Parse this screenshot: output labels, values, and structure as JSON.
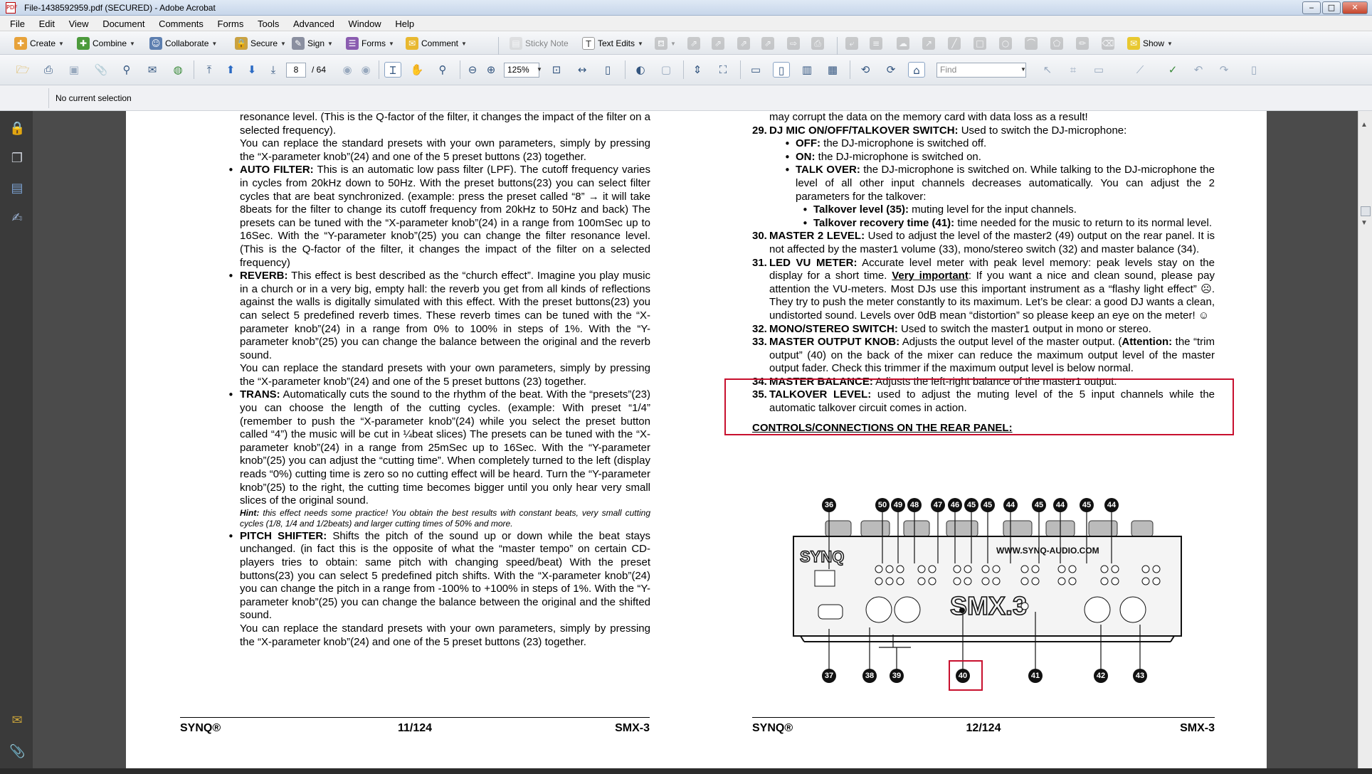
{
  "window": {
    "title": "File-1438592959.pdf (SECURED) - Adobe Acrobat",
    "app_icon": "pdf-icon",
    "controls": {
      "minimize": "‒",
      "maximize": "□",
      "close": "✕"
    }
  },
  "menu": [
    "File",
    "Edit",
    "View",
    "Document",
    "Comments",
    "Forms",
    "Tools",
    "Advanced",
    "Window",
    "Help"
  ],
  "toolbar1": {
    "create": "Create",
    "combine": "Combine",
    "collaborate": "Collaborate",
    "secure": "Secure",
    "sign": "Sign",
    "forms": "Forms",
    "comment": "Comment",
    "sticky_note": "Sticky Note",
    "text_edits": "Text Edits",
    "show": "Show"
  },
  "toolbar2": {
    "page_current": "8",
    "page_total": "/ 64",
    "zoom": "125%",
    "find_placeholder": "Find"
  },
  "status": {
    "selection": "No current selection"
  },
  "left_column": {
    "p1": "resonance level. (This is the Q-factor of the filter, it changes the impact of the filter on a selected frequency).",
    "p2": "You can replace the standard presets with your own parameters, simply by pressing the “X-parameter knob”(24) and one of the 5 preset buttons (23) together.",
    "autofilter_head": "AUTO FILTER:",
    "autofilter_text": " This is an automatic low pass filter (LPF). The cutoff frequency varies in cycles from 20kHz down to 50Hz. With the preset buttons(23) you can select filter cycles that are beat synchronized. (example: press the preset called “8” → it will take 8beats for the filter to change its cutoff frequency from 20kHz to 50Hz and back) The presets can be tuned with the “X-parameter knob”(24) in a range from 100mSec up to 16Sec. With the “Y-parameter knob”(25) you can change the filter resonance level. (This is the Q-factor of the filter, it changes the impact of the filter on a selected frequency)",
    "reverb_head": "REVERB:",
    "reverb_text": " This effect is best described as the “church effect”. Imagine you play music in a church or in a very big, empty hall: the reverb you get from all kinds of reflections against the walls is digitally simulated with this effect. With the preset buttons(23) you can select 5 predefined reverb times. These reverb times can be tuned with the “X-parameter knob”(24) in a range from 0% to 100% in steps of 1%. With the “Y-parameter knob”(25) you can change the balance between the original and the reverb sound.",
    "reverb_p2": "You can replace the standard presets with your own parameters, simply by pressing the “X-parameter knob”(24) and one of the 5 preset buttons (23) together.",
    "trans_head": "TRANS:",
    "trans_text": " Automatically cuts the sound to the rhythm of the beat. With the “presets”(23) you can choose the length of the cutting cycles. (example: With preset “1/4” (remember to push the “X-parameter knob”(24) while you select the preset button called “4”) the music will be cut in ¼beat slices) The presets can be tuned with the “X-parameter knob”(24) in a range from 25mSec up to 16Sec. With the “Y-parameter knob”(25) you can adjust the “cutting time”. When completely turned to the left (display reads “0%) cutting time is zero so no cutting effect will be heard. Turn the “Y-parameter knob”(25) to the right, the cutting time becomes bigger until you only hear very small slices of the original sound.",
    "hint_head": "Hint:",
    "hint_text": " this effect needs some practice! You obtain the best results with constant beats, very small cutting cycles (1/8, 1/4 and 1/2beats) and larger cutting times of 50% and more.",
    "pitch_head": "PITCH SHIFTER:",
    "pitch_text": " Shifts the pitch of the sound up or down while the beat stays unchanged. (in fact this is the opposite of what the “master tempo” on certain CD-players tries to obtain: same pitch with changing speed/beat) With the preset buttons(23) you can select 5 predefined pitch shifts. With the “X-parameter knob”(24) you can change the pitch in a range from -100% to +100% in steps of 1%. With the “Y-parameter knob”(25) you can change the balance between the original and the shifted sound.",
    "pitch_p2": "You can replace the standard presets with your own parameters, simply by pressing the “X-parameter knob”(24) and one of the 5 preset buttons (23) together."
  },
  "right_column": {
    "p0": "may corrupt the data on the memory card with data loss as a result!",
    "n29": "29.",
    "i29_head": "DJ MIC ON/OFF/TALKOVER SWITCH:",
    "i29_text": " Used to switch the DJ-microphone:",
    "off_head": "OFF:",
    "off_text": " the DJ-microphone is switched off.",
    "on_head": "ON:",
    "on_text": " the DJ-microphone is switched on.",
    "talk_head": "TALK OVER:",
    "talk_text": " the DJ-microphone is switched on. While talking to the DJ-microphone the level of all other input channels decreases automatically. You can adjust the 2 parameters for the talkover:",
    "tl_head": "Talkover level (35):",
    "tl_text": " muting level for the input channels.",
    "tr_head": "Talkover recovery time (41):",
    "tr_text": " time needed for the music to return to its normal level.",
    "n30": "30.",
    "i30_head": "MASTER 2 LEVEL:",
    "i30_text": " Used to adjust the level of the master2 (49) output on the rear panel. It is not affected by the master1 volume (33), mono/stereo switch (32) and master balance (34).",
    "n31": "31.",
    "i31_head": "LED VU METER:",
    "i31_text1": " Accurate level meter with peak level memory: peak levels stay on the display for a short time. ",
    "i31_imp": "Very important",
    "i31_text2": ": If you want a nice and clean sound, please pay attention the VU-meters. Most DJs use this important instrument as a “flashy light effect” ☹. They try to push the meter constantly to its maximum. Let’s be clear: a good DJ wants a clean, undistorted sound. Levels over 0dB mean “distortion” so please keep an eye on the meter! ☺",
    "n32": "32.",
    "i32_head": "MONO/STEREO SWITCH:",
    "i32_text": " Used to switch the master1 output in mono or stereo.",
    "n33": "33.",
    "i33_head": "MASTER OUTPUT KNOB:",
    "i33_text1": " Adjusts the output level of the master output. (",
    "i33_att": "Attention:",
    "i33_text2": " the “trim output” (40) on the back of the mixer can reduce the maximum output level of the master output fader. Check this trimmer if the maximum output level is below normal.",
    "n34": "34.",
    "i34_head": "MASTER BALANCE:",
    "i34_text": " Adjusts the left-right balance of the master1 output.",
    "n35": "35.",
    "i35_head": "TALKOVER LEVEL:",
    "i35_text": " used to adjust the muting level of the 5 input channels while the automatic talkover circuit comes in action.",
    "rear_title": "CONTROLS/CONNECTIONS ON THE REAR PANEL:"
  },
  "diagram": {
    "website": "WWW.SYNQ-AUDIO.COM",
    "logo": "SYNQ",
    "model": "SMX.3",
    "top_callouts": [
      "36",
      "50",
      "49",
      "48",
      "47",
      "46",
      "45",
      "45",
      "44",
      "45",
      "44",
      "45",
      "44"
    ],
    "bottom_callouts": [
      "37",
      "38",
      "39",
      "40",
      "41",
      "42",
      "43"
    ]
  },
  "footer_left": {
    "brand": "SYNQ®",
    "page": "11/124",
    "model": "SMX-3"
  },
  "footer_right": {
    "brand": "SYNQ®",
    "page": "12/124",
    "model": "SMX-3"
  },
  "colors": {
    "highlight": "#c8102e"
  }
}
